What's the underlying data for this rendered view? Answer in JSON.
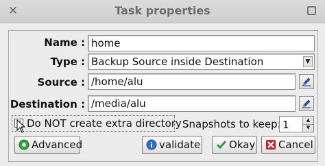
{
  "window": {
    "title": "Task properties",
    "close_glyph": "✕"
  },
  "form": {
    "name_label": "Name :",
    "name_value": "home",
    "type_label": "Type :",
    "type_value": "Backup Source inside Destination",
    "source_label": "Source :",
    "source_value": "/home/alu",
    "destination_label": "Destination :",
    "destination_value": "/media/alu"
  },
  "options": {
    "no_extra_dir_label": "Do NOT create extra directory",
    "no_extra_dir_checked": true,
    "snapshots_label": "Snapshots to keep:",
    "snapshots_value": "1"
  },
  "buttons": {
    "advanced": "Advanced",
    "validate": "validate",
    "okay": "Okay",
    "cancel": "Cancel"
  },
  "colors": {
    "advanced_icon": "#3aa03a",
    "validate_icon": "#2f6fd0",
    "okay_icon": "#2e9a2e",
    "cancel_icon": "#d02020",
    "browse_icon": "#2b5fb0"
  },
  "icons": {
    "advanced": "gear-icon",
    "validate": "info-icon",
    "okay": "checkmark-icon",
    "cancel": "cross-icon",
    "browse": "pencil-icon",
    "dropdown": "chevron-down-icon"
  }
}
